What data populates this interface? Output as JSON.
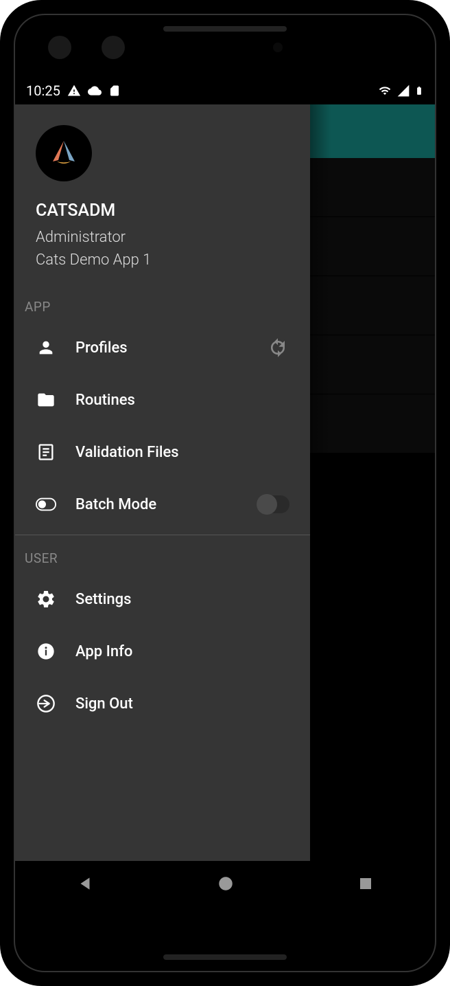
{
  "status": {
    "time": "10:25"
  },
  "drawer": {
    "header": {
      "username": "CATSADM",
      "role": "Administrator",
      "app_name": "Cats Demo App 1"
    },
    "sections": {
      "app": {
        "label": "APP",
        "items": [
          {
            "label": "Profiles",
            "icon": "person-icon",
            "has_refresh": true
          },
          {
            "label": "Routines",
            "icon": "folder-icon"
          },
          {
            "label": "Validation Files",
            "icon": "document-icon"
          },
          {
            "label": "Batch Mode",
            "icon": "toggle-icon",
            "switch": false
          }
        ]
      },
      "user": {
        "label": "USER",
        "items": [
          {
            "label": "Settings",
            "icon": "gear-icon"
          },
          {
            "label": "App Info",
            "icon": "info-icon"
          },
          {
            "label": "Sign Out",
            "icon": "signout-icon"
          }
        ]
      }
    }
  },
  "colors": {
    "appbar": "#0d5753",
    "drawer_bg": "#353535"
  }
}
